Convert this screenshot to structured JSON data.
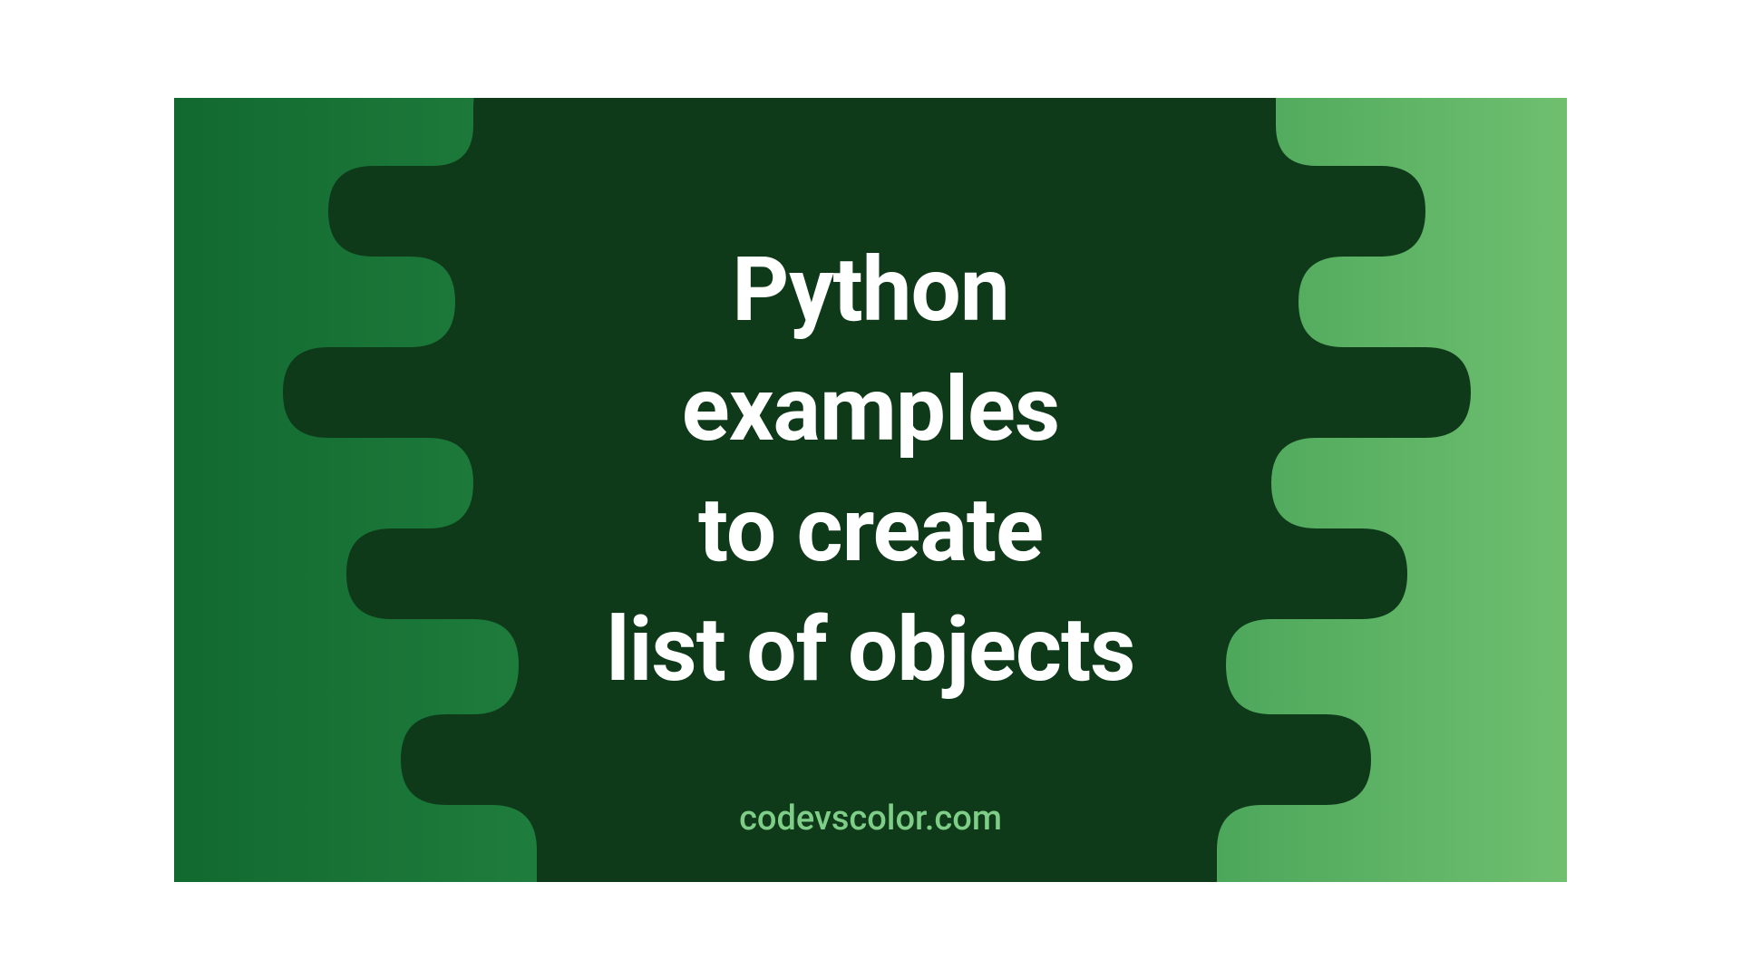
{
  "banner": {
    "title_lines": "Python\nexamples\nto create\nlist of objects",
    "footer": "codevscolor.com"
  },
  "colors": {
    "blob": "#0f3a1a",
    "text": "#ffffff",
    "footer_text": "#7fce88",
    "gradient_start": "#126930",
    "gradient_end": "#6fbf6f"
  }
}
